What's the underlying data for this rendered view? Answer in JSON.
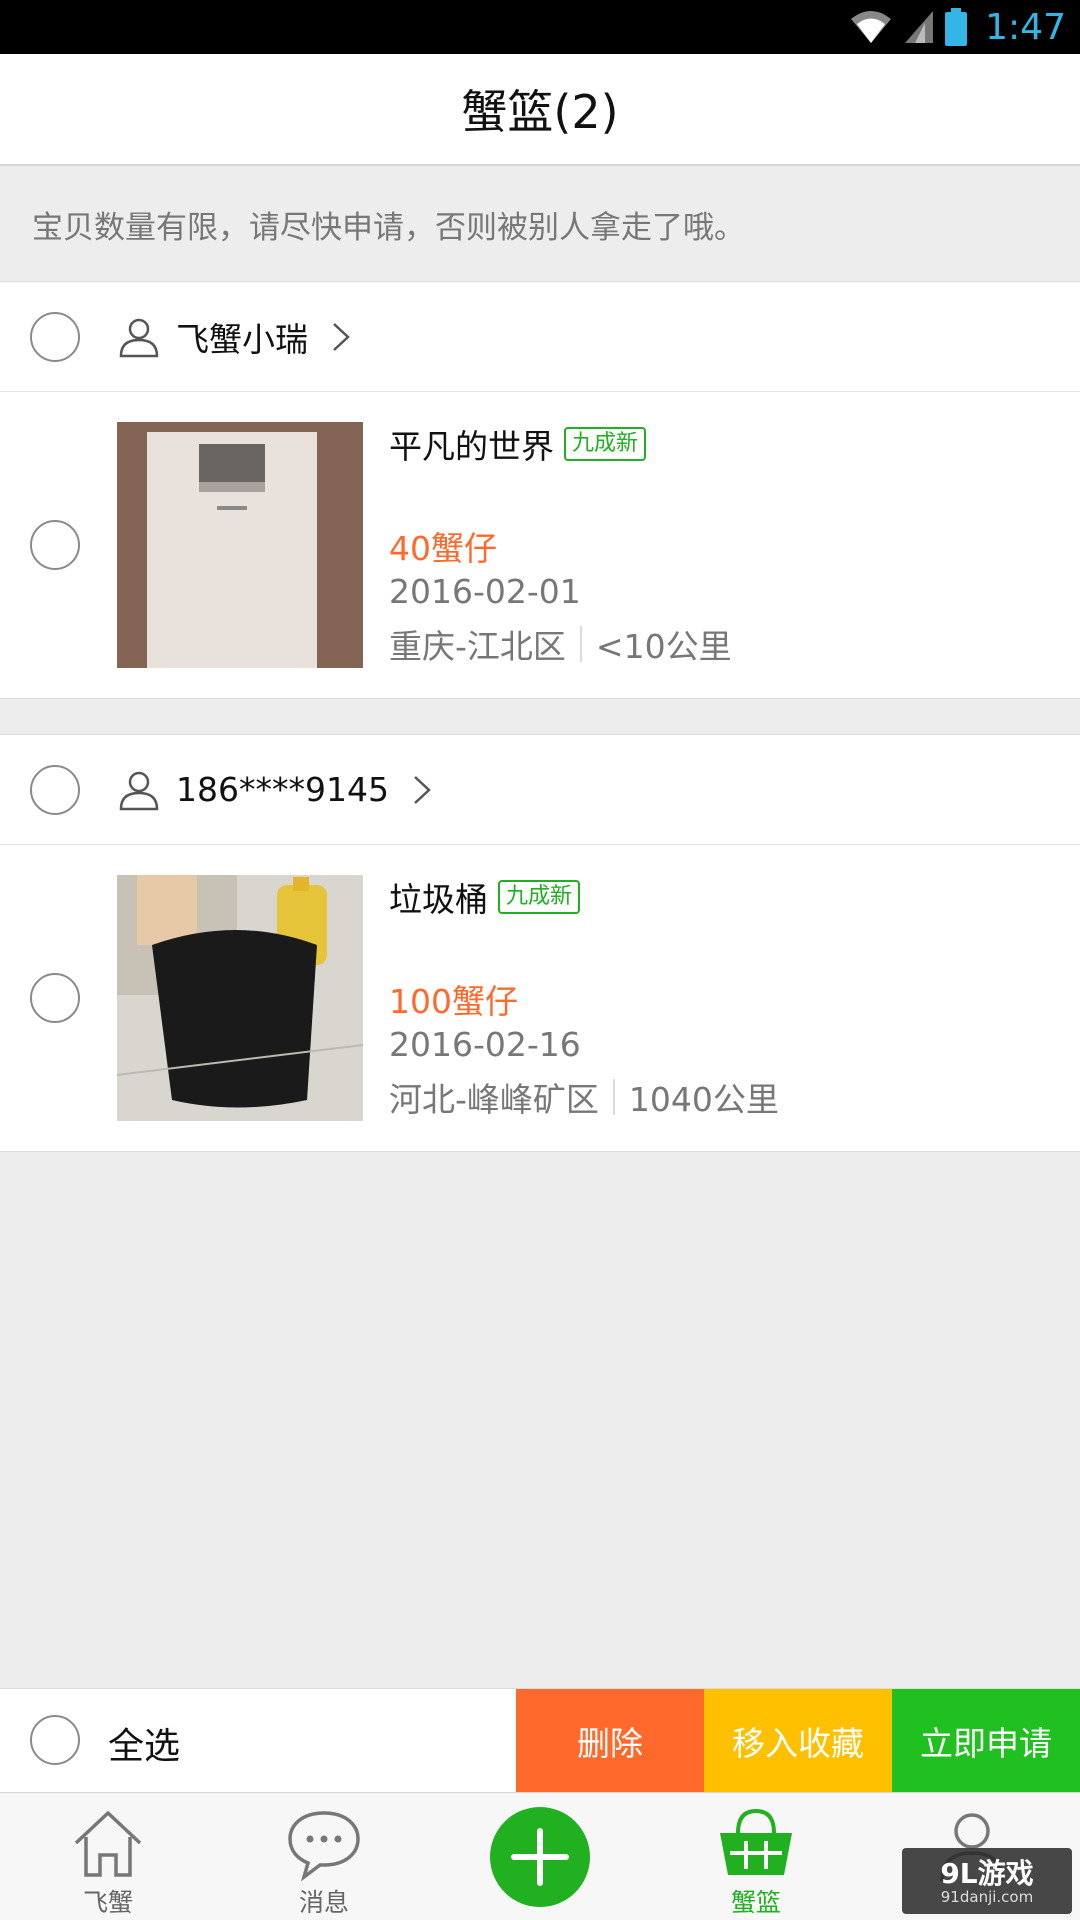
{
  "status_bar": {
    "time": "1:47",
    "icons": [
      "wifi-icon",
      "signal-icon",
      "battery-icon"
    ],
    "time_color": "#33b5e5"
  },
  "header": {
    "title": "蟹篮(2)"
  },
  "notice": "宝贝数量有限，请尽快申请，否则被别人拿走了哦。",
  "groups": [
    {
      "seller": "飞蟹小瑞",
      "item": {
        "title": "平凡的世界",
        "condition": "九成新",
        "price": "40蟹仔",
        "date": "2016-02-01",
        "location": "重庆-江北区",
        "distance": "<10公里"
      }
    },
    {
      "seller": "186****9145",
      "item": {
        "title": "垃圾桶",
        "condition": "九成新",
        "price": "100蟹仔",
        "date": "2016-02-16",
        "location": "河北-峰峰矿区",
        "distance": "1040公里"
      }
    }
  ],
  "actions": {
    "select_all": "全选",
    "delete": "删除",
    "move_to_favorites": "移入收藏",
    "apply_now": "立即申请"
  },
  "tabs": [
    {
      "label": "飞蟹",
      "icon": "home-icon"
    },
    {
      "label": "消息",
      "icon": "chat-icon"
    },
    {
      "label": "",
      "icon": "add-icon"
    },
    {
      "label": "蟹篮",
      "icon": "basket-icon",
      "active": true
    },
    {
      "label": "",
      "icon": "user-icon"
    }
  ],
  "colors": {
    "accent_green": "#20b020",
    "price_orange": "#ff6a2c",
    "delete_orange": "#ff6a2c",
    "favorite_yellow": "#ffc000",
    "apply_green": "#20c020"
  },
  "watermark": {
    "main": "9L游戏",
    "sub": "91danji.com"
  }
}
